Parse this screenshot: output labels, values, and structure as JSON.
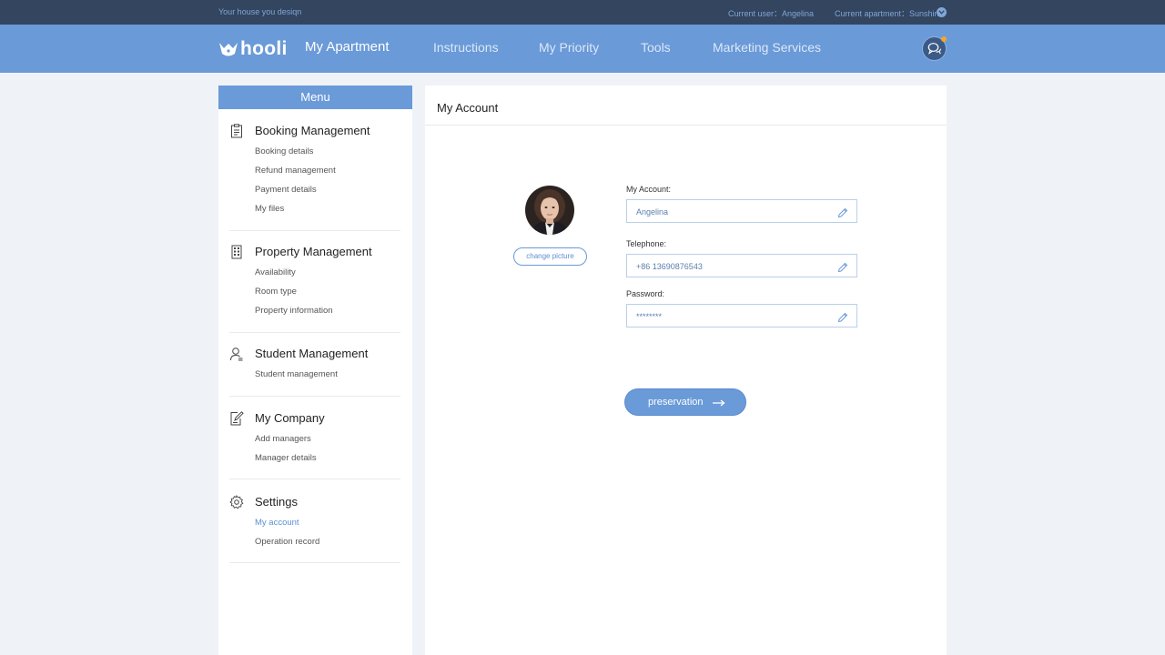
{
  "topbar": {
    "tagline": "Your house you desiqn",
    "current_user": "Current user：Angelina",
    "current_apartment": "Current apartment：Sunshine"
  },
  "nav": {
    "logo_text": "hooli",
    "items": [
      {
        "label": "My Apartment",
        "active": true
      },
      {
        "label": "Instructions"
      },
      {
        "label": "My Priority"
      },
      {
        "label": "Tools"
      },
      {
        "label": "Marketing Services"
      }
    ]
  },
  "sidebar": {
    "title": "Menu",
    "sections": [
      {
        "title": "Booking Management",
        "icon": "clipboard-icon",
        "items": [
          "Booking details",
          "Refund management",
          "Payment details",
          "My files"
        ]
      },
      {
        "title": "Property Management",
        "icon": "building-icon",
        "items": [
          "Availability",
          "Room type",
          "Property information"
        ]
      },
      {
        "title": "Student Management",
        "icon": "user-icon",
        "items": [
          "Student management"
        ]
      },
      {
        "title": "My Company",
        "icon": "edit-document-icon",
        "items": [
          "Add managers",
          "Manager details"
        ]
      },
      {
        "title": "Settings",
        "icon": "gear-icon",
        "items": [
          "My account",
          "Operation record"
        ],
        "active_item": "My account"
      }
    ]
  },
  "main": {
    "title": "My Account",
    "change_picture": "change picture",
    "fields": {
      "account": {
        "label": "My Account:",
        "value": "Angelina"
      },
      "telephone": {
        "label": "Telephone:",
        "value": "+86 13690876543"
      },
      "password": {
        "label": "Password:",
        "value": "********"
      }
    },
    "save_button": "preservation"
  },
  "colors": {
    "accent": "#6a9ad8",
    "topbar": "#33455f",
    "link": "#5b8fd3",
    "notification": "#f5a623"
  }
}
